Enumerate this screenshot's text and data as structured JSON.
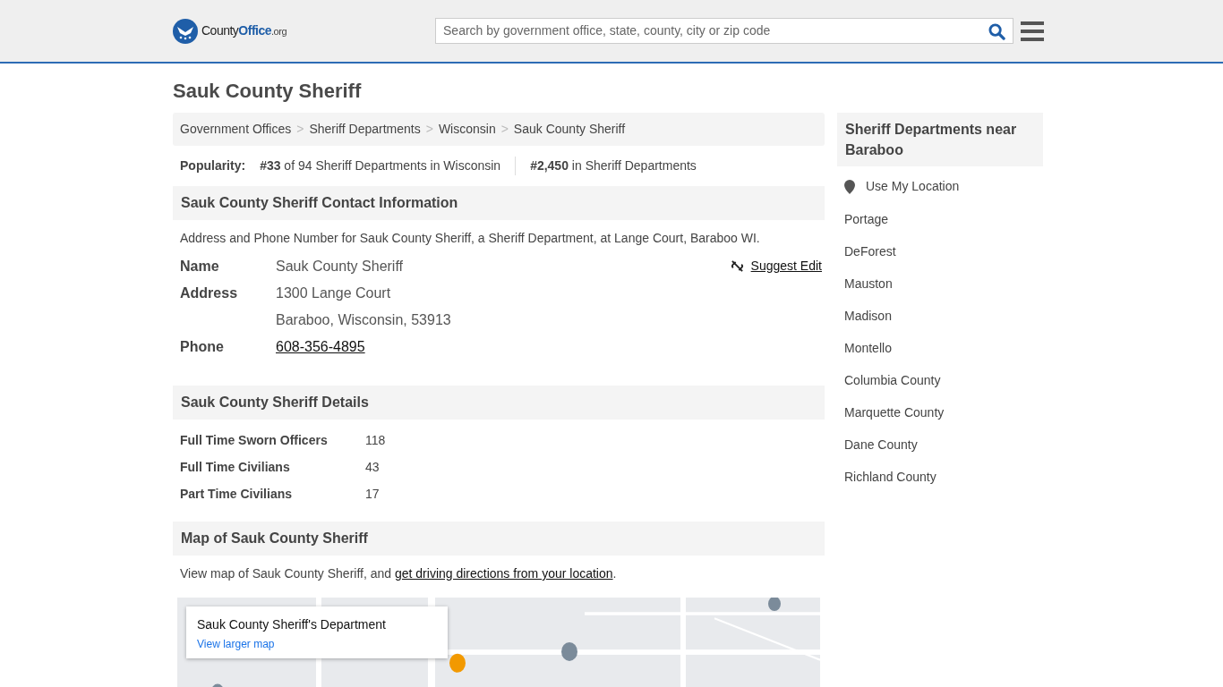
{
  "header": {
    "logo": {
      "name": "County",
      "bold": "Office",
      "suffix": ".org"
    },
    "search": {
      "placeholder": "Search by government office, state, county, city or zip code"
    }
  },
  "title": "Sauk County Sheriff",
  "breadcrumbs": [
    "Government Offices",
    "Sheriff Departments",
    "Wisconsin",
    "Sauk County Sheriff"
  ],
  "breadcrumb_separator": ">",
  "popularity": {
    "label": "Popularity:",
    "items": [
      {
        "rank": "#33",
        "text": "of 94 Sheriff Departments in Wisconsin"
      },
      {
        "rank": "#2,450",
        "text": "in Sheriff Departments"
      }
    ]
  },
  "contact": {
    "heading": "Sauk County Sheriff Contact Information",
    "intro": "Address and Phone Number for Sauk County Sheriff, a Sheriff Department, at Lange Court, Baraboo WI.",
    "suggest_edit": "Suggest Edit",
    "rows": [
      {
        "label": "Name",
        "lines": [
          "Sauk County Sheriff"
        ],
        "kind": "text"
      },
      {
        "label": "Address",
        "lines": [
          "1300 Lange Court",
          "Baraboo, Wisconsin, 53913"
        ],
        "kind": "text"
      },
      {
        "label": "Phone",
        "lines": [
          "608-356-4895"
        ],
        "kind": "link"
      }
    ]
  },
  "details": {
    "heading": "Sauk County Sheriff Details",
    "rows": [
      {
        "label": "Full Time Sworn Officers",
        "value": "118"
      },
      {
        "label": "Full Time Civilians",
        "value": "43"
      },
      {
        "label": "Part Time Civilians",
        "value": "17"
      }
    ]
  },
  "map": {
    "heading": "Map of Sauk County Sheriff",
    "intro": "View map of Sauk County Sheriff, and ",
    "link": "get driving directions from your location",
    "after": ".",
    "card_title": "Sauk County Sheriff's Department",
    "card_link": "View larger map"
  },
  "sidebar": {
    "heading": "Sheriff Departments near Baraboo",
    "use_location": "Use My Location",
    "links": [
      "Portage",
      "DeForest",
      "Mauston",
      "Madison",
      "Montello",
      "Columbia County",
      "Marquette County",
      "Dane County",
      "Richland County"
    ]
  }
}
